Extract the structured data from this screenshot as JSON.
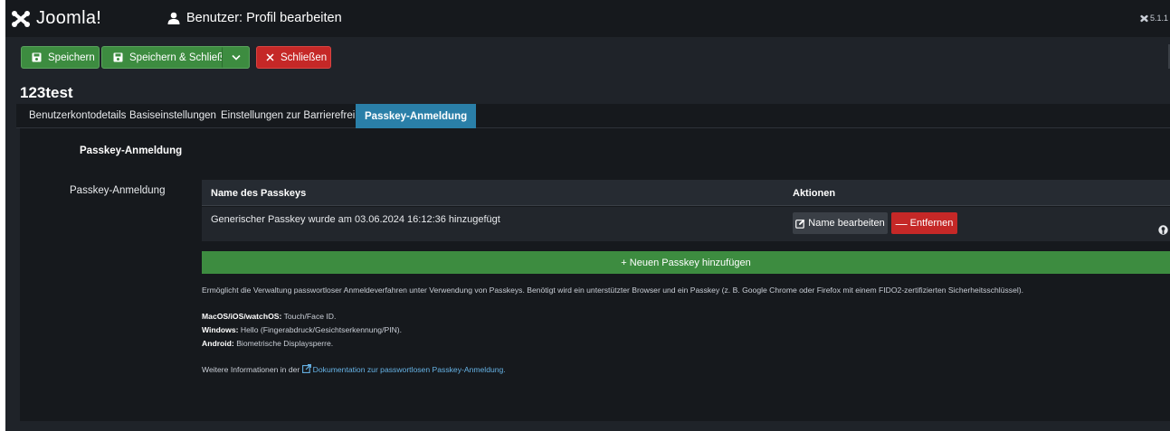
{
  "header": {
    "brand": "Joomla!",
    "page_title": "Benutzer: Profil bearbeiten",
    "version": "5.1.1"
  },
  "toolbar": {
    "save_label": "Speichern",
    "save_close_label": "Speichern & Schließen",
    "close_label": "Schließen"
  },
  "record": {
    "title": "123test"
  },
  "tabs": [
    {
      "label": "Benutzerkontodetails",
      "active": false
    },
    {
      "label": "Basiseinstellungen",
      "active": false
    },
    {
      "label": "Einstellungen zur Barrierefreiheit",
      "active": false
    },
    {
      "label": "Passkey-Anmeldung",
      "active": true
    }
  ],
  "passkey": {
    "legend": "Passkey-Anmeldung",
    "field_label": "Passkey-Anmeldung",
    "table": {
      "col_name": "Name des Passkeys",
      "col_actions": "Aktionen",
      "rows": [
        {
          "name": "Generischer Passkey wurde am 03.06.2024 16:12:36 hinzugefügt",
          "edit_label": "Name bearbeiten",
          "remove_label": "Entfernen"
        }
      ]
    },
    "add_label": "+ Neuen Passkey hinzufügen",
    "description": "Ermöglicht die Verwaltung passwortloser Anmeldeverfahren unter Verwendung von Passkeys. Benötigt wird ein unterstützter Browser und ein Passkey (z. B. Google Chrome oder Firefox mit einem FIDO2-zertifizierten Sicherheitsschlüssel).",
    "platforms": [
      {
        "name": "MacOS/iOS/watchOS:",
        "value": "Touch/Face ID."
      },
      {
        "name": "Windows:",
        "value": "Hello (Fingerabdruck/Gesichtserkennung/PIN)."
      },
      {
        "name": "Android:",
        "value": "Biometrische Displaysperre."
      }
    ],
    "more_info_prefix": "Weitere Informationen in der",
    "more_info_link": "Dokumentation zur passwortlosen Passkey-Anmeldung."
  },
  "colors": {
    "success": "#3d8c40",
    "danger": "#c52827",
    "active_tab": "#2a7fa8",
    "link": "#66b3e6"
  }
}
